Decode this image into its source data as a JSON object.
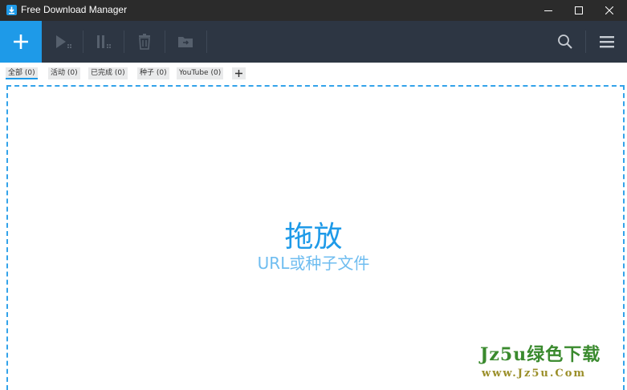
{
  "window": {
    "title": "Free Download Manager",
    "icons": [
      "app-icon",
      "minimize-icon",
      "maximize-icon",
      "close-icon"
    ]
  },
  "toolbar": {
    "buttons": [
      "add-icon",
      "play-icon",
      "pause-icon",
      "trash-icon",
      "move-folder-icon",
      "search-icon",
      "menu-icon"
    ],
    "accent_color": "#1e9ae8",
    "background_color": "#2d3643"
  },
  "tabs": {
    "items": [
      {
        "label": "全部 (0)",
        "active": true
      },
      {
        "label": "活动 (0)",
        "active": false
      },
      {
        "label": "已完成 (0)",
        "active": false
      },
      {
        "label": "种子 (0)",
        "active": false
      },
      {
        "label": "YouTube (0)",
        "active": false
      }
    ],
    "add_icon": "plus-icon"
  },
  "dropzone": {
    "title": "拖放",
    "subtitle": "URL或种子文件"
  },
  "watermark": {
    "main": "Jz5u绿色下载",
    "sub": "www.Jz5u.Com"
  }
}
